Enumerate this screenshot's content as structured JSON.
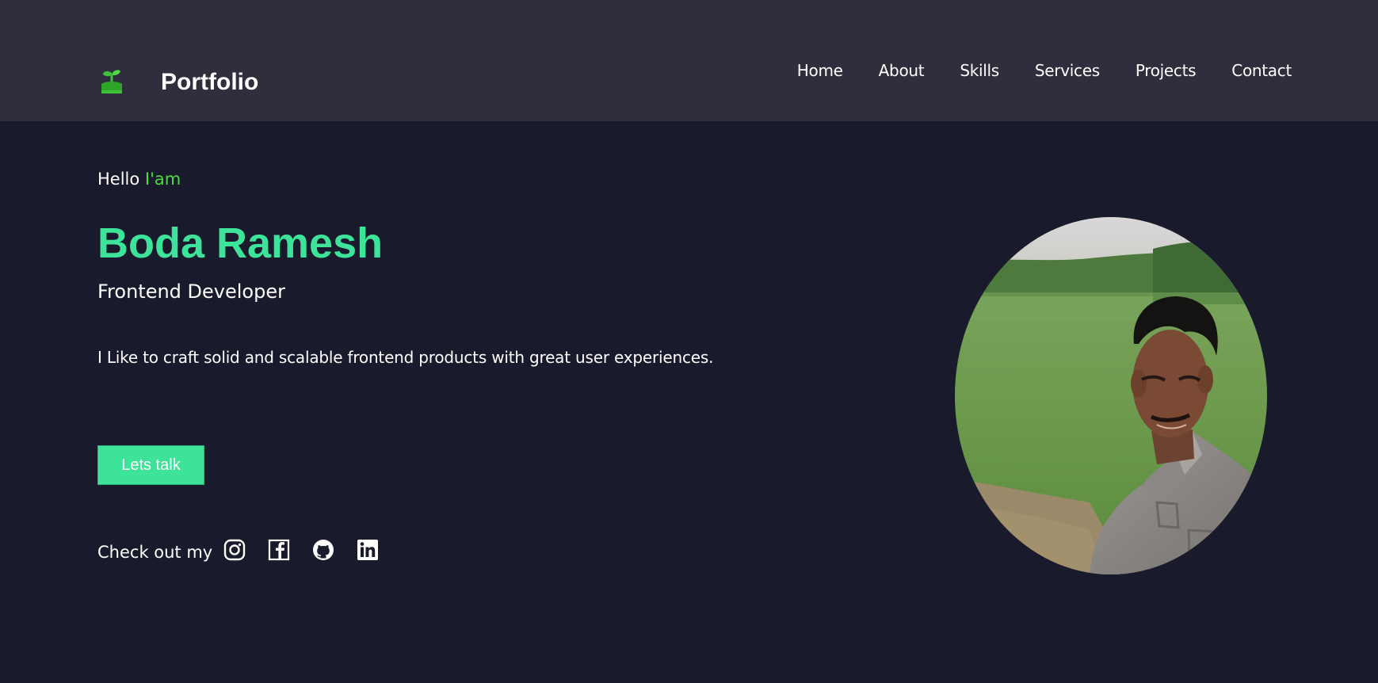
{
  "brand": {
    "name": "Portfolio",
    "logo_icon": "leaf-sprout-icon",
    "logo_color": "#3fc23a"
  },
  "nav": {
    "items": [
      {
        "label": "Home"
      },
      {
        "label": "About"
      },
      {
        "label": "Skills"
      },
      {
        "label": "Services"
      },
      {
        "label": "Projects"
      },
      {
        "label": "Contact"
      }
    ]
  },
  "hero": {
    "greeting_prefix": "Hello",
    "greeting_accent": "I'am",
    "name": "Boda Ramesh",
    "role": "Frontend Developer",
    "tagline": "I Like to craft solid and scalable frontend products with great user experiences.",
    "cta_label": "Lets talk",
    "social_label": "Check out my",
    "social_icons": [
      "instagram-icon",
      "facebook-icon",
      "github-icon",
      "linkedin-icon"
    ],
    "portrait": "profile-photo"
  },
  "colors": {
    "background": "#1a1a2d",
    "navbar": "#2e2e3c",
    "accent_green": "#3ee39a",
    "greeting_green": "#4ade3b",
    "text": "#ffffff"
  }
}
